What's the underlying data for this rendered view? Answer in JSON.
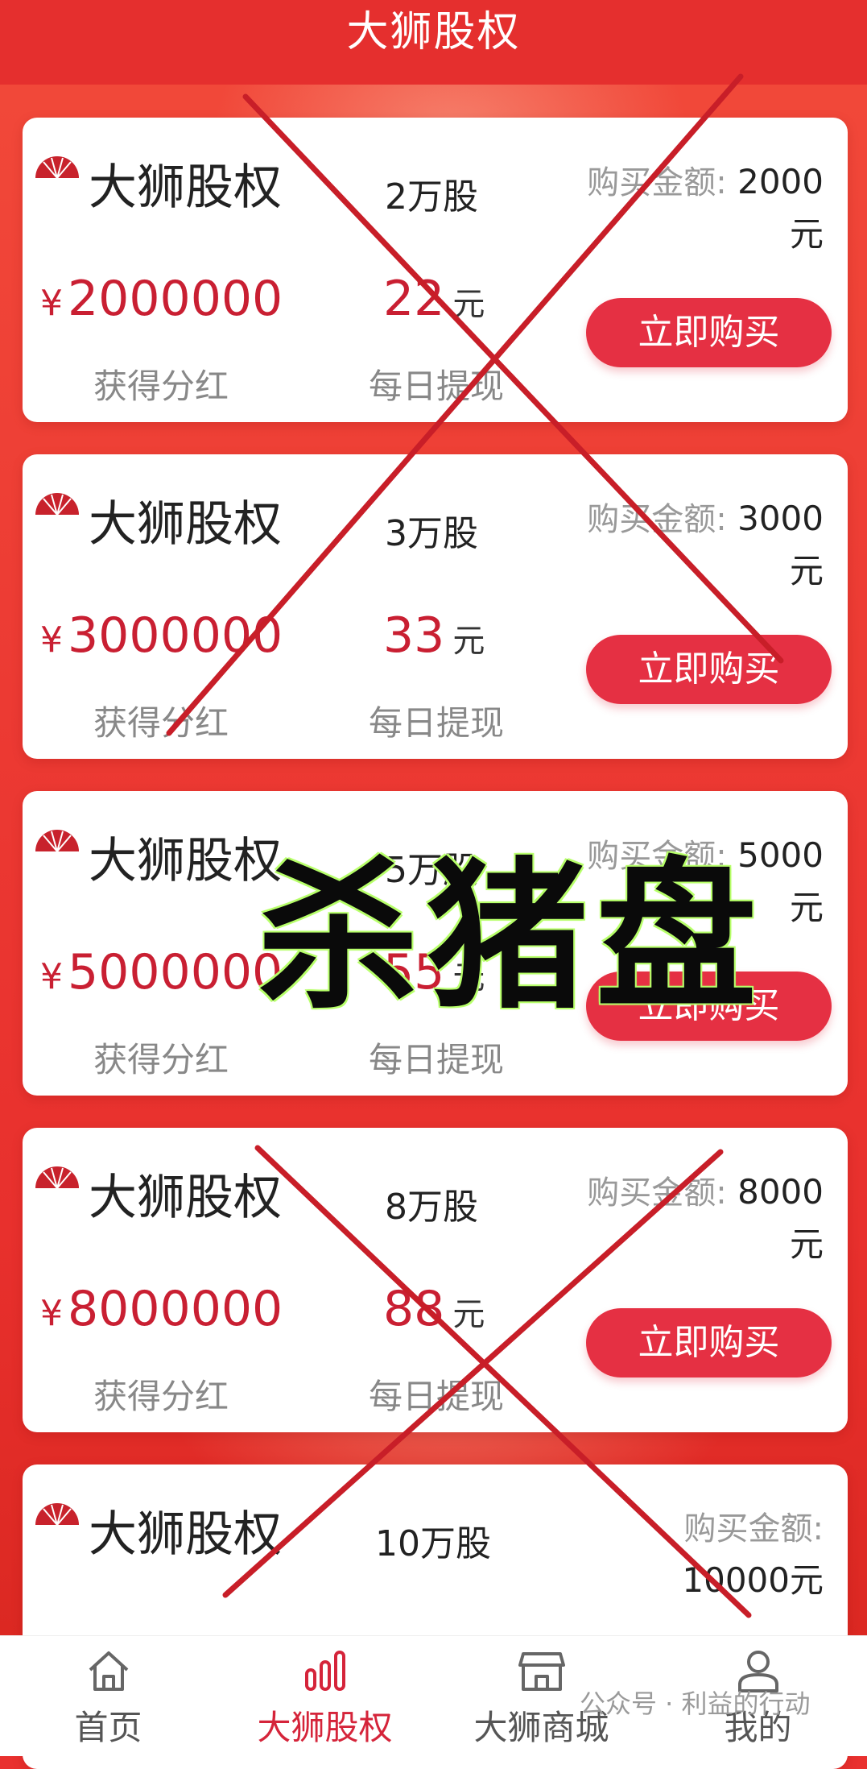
{
  "header": {
    "title": "大狮股权"
  },
  "products": [
    {
      "name": "大狮股权",
      "shares": "2万股",
      "price_label": "购买金额:",
      "price": "2000",
      "price_unit": "元",
      "currency": "¥",
      "dividend": "2000000",
      "dividend_label": "获得分红",
      "daily": "22",
      "daily_unit": "元",
      "daily_label": "每日提现",
      "buy_label": "立即购买"
    },
    {
      "name": "大狮股权",
      "shares": "3万股",
      "price_label": "购买金额:",
      "price": "3000",
      "price_unit": "元",
      "currency": "¥",
      "dividend": "3000000",
      "dividend_label": "获得分红",
      "daily": "33",
      "daily_unit": "元",
      "daily_label": "每日提现",
      "buy_label": "立即购买"
    },
    {
      "name": "大狮股权",
      "shares": "5万股",
      "price_label": "购买金额:",
      "price": "5000",
      "price_unit": "元",
      "currency": "¥",
      "dividend": "5000000",
      "dividend_label": "获得分红",
      "daily": "55",
      "daily_unit": "元",
      "daily_label": "每日提现",
      "buy_label": "立即购买"
    },
    {
      "name": "大狮股权",
      "shares": "8万股",
      "price_label": "购买金额:",
      "price": "8000",
      "price_unit": "元",
      "currency": "¥",
      "dividend": "8000000",
      "dividend_label": "获得分红",
      "daily": "88",
      "daily_unit": "元",
      "daily_label": "每日提现",
      "buy_label": "立即购买"
    },
    {
      "name": "大狮股权",
      "shares": "10万股",
      "price_label": "购买金额:",
      "price": "10000元",
      "price_unit": "",
      "currency": "",
      "dividend": "",
      "dividend_label": "",
      "daily": "",
      "daily_unit": "",
      "daily_label": "",
      "buy_label": ""
    }
  ],
  "tabbar": {
    "tabs": [
      {
        "label": "首页",
        "icon": "home-icon"
      },
      {
        "label": "大狮股权",
        "icon": "bar-chart-icon"
      },
      {
        "label": "大狮商城",
        "icon": "store-icon"
      },
      {
        "label": "我的",
        "icon": "user-icon"
      }
    ]
  },
  "overlay": {
    "stamp_text": "杀猪盘",
    "watermark": "公众号 · 利益的行动"
  },
  "colors": {
    "brand_red": "#e52f2e",
    "price_red": "#c91f32",
    "button_red": "#e53043",
    "cross_red": "#c81e28"
  }
}
